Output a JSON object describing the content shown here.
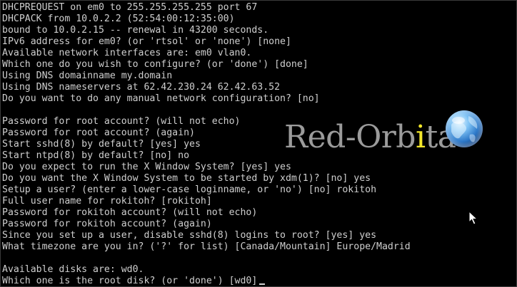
{
  "terminal": {
    "lines": [
      "DHCPREQUEST on em0 to 255.255.255.255 port 67",
      "DHCPACK from 10.0.2.2 (52:54:00:12:35:00)",
      "bound to 10.0.2.15 -- renewal in 43200 seconds.",
      "IPv6 address for em0? (or 'rtsol' or 'none') [none]",
      "Available network interfaces are: em0 vlan0.",
      "Which one do you wish to configure? (or 'done') [done]",
      "Using DNS domainname my.domain",
      "Using DNS nameservers at 62.42.230.24 62.42.63.52",
      "Do you want to do any manual network configuration? [no]",
      "",
      "Password for root account? (will not echo)",
      "Password for root account? (again)",
      "Start sshd(8) by default? [yes] yes",
      "Start ntpd(8) by default? [no] no",
      "Do you expect to run the X Window System? [yes] yes",
      "Do you want the X Window System to be started by xdm(1)? [no] yes",
      "Setup a user? (enter a lower-case loginname, or 'no') [no] rokitoh",
      "Full user name for rokitoh? [rokitoh]",
      "Password for rokitoh account? (will not echo)",
      "Password for rokitoh account? (again)",
      "Since you set up a user, disable sshd(8) logins to root? [yes] yes",
      "What timezone are you in? ('?' for list) [Canada/Mountain] Europe/Madrid",
      "",
      "Available disks are: wd0.",
      "Which one is the root disk? (or 'done') [wd0]"
    ]
  },
  "watermark": {
    "text_before": "Red-Orb",
    "text_accent": "i",
    "text_after": "ta",
    "icon": "globe-icon"
  },
  "pointer": {
    "icon": "mouse-pointer-icon"
  },
  "colors": {
    "background": "#000000",
    "text": "#cfcfcf",
    "watermark_text": "#d7d7d7",
    "watermark_accent": "#f2e62a",
    "globe": "#3f8fd8"
  }
}
